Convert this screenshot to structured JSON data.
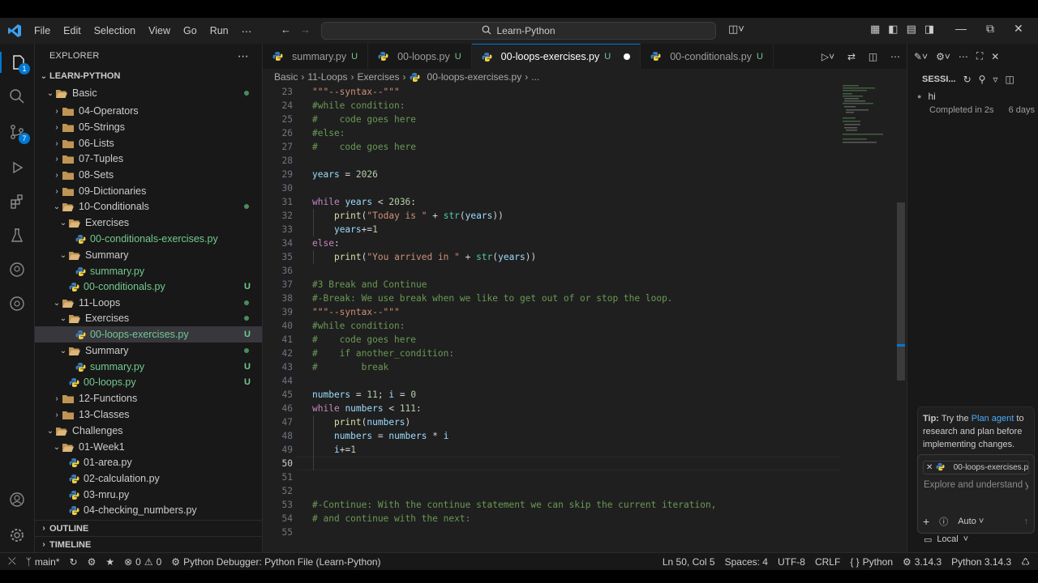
{
  "menu": [
    "File",
    "Edit",
    "Selection",
    "View",
    "Go",
    "Run",
    "⋯"
  ],
  "search": {
    "label": "Learn-Python"
  },
  "activity": {
    "explorer_badge": "1",
    "scm_badge": "7"
  },
  "explorer": {
    "title": "EXPLORER",
    "root": "LEARN-PYTHON",
    "items": [
      {
        "label": "Basic",
        "kind": "folder-open",
        "depth": 1
      },
      {
        "label": "04-Operators",
        "kind": "folder",
        "depth": 2
      },
      {
        "label": "05-Strings",
        "kind": "folder",
        "depth": 2
      },
      {
        "label": "06-Lists",
        "kind": "folder",
        "depth": 2
      },
      {
        "label": "07-Tuples",
        "kind": "folder",
        "depth": 2
      },
      {
        "label": "08-Sets",
        "kind": "folder",
        "depth": 2
      },
      {
        "label": "09-Dictionaries",
        "kind": "folder",
        "depth": 2
      },
      {
        "label": "10-Conditionals",
        "kind": "folder-open",
        "depth": 2
      },
      {
        "label": "Exercises",
        "kind": "folder-open",
        "depth": 3
      },
      {
        "label": "00-conditionals-exercises.py",
        "kind": "py",
        "depth": 4
      },
      {
        "label": "Summary",
        "kind": "folder-open",
        "depth": 3
      },
      {
        "label": "summary.py",
        "kind": "py",
        "depth": 4
      },
      {
        "label": "00-conditionals.py",
        "kind": "py",
        "depth": 3
      },
      {
        "label": "11-Loops",
        "kind": "folder-open",
        "depth": 2
      },
      {
        "label": "Exercises",
        "kind": "folder-open",
        "depth": 3
      },
      {
        "label": "00-loops-exercises.py",
        "kind": "py",
        "depth": 4
      },
      {
        "label": "Summary",
        "kind": "folder-open",
        "depth": 3
      },
      {
        "label": "summary.py",
        "kind": "py",
        "depth": 4
      },
      {
        "label": "00-loops.py",
        "kind": "py",
        "depth": 3
      },
      {
        "label": "12-Functions",
        "kind": "folder",
        "depth": 2
      },
      {
        "label": "13-Classes",
        "kind": "folder",
        "depth": 2
      },
      {
        "label": "Challenges",
        "kind": "folder-open",
        "depth": 1
      },
      {
        "label": "01-Week1",
        "kind": "folder-open",
        "depth": 2
      },
      {
        "label": "01-area.py",
        "kind": "py",
        "depth": 3
      },
      {
        "label": "02-calculation.py",
        "kind": "py",
        "depth": 3
      },
      {
        "label": "03-mru.py",
        "kind": "py",
        "depth": 3
      },
      {
        "label": "04-checking_numbers.py",
        "kind": "py",
        "depth": 3
      }
    ],
    "git_marker": "U",
    "outline": "OUTLINE",
    "timeline": "TIMELINE"
  },
  "tabs": [
    {
      "label": "summary.py",
      "status": "U"
    },
    {
      "label": "00-loops.py",
      "status": "U"
    },
    {
      "label": "00-loops-exercises.py",
      "status": "U"
    },
    {
      "label": "00-conditionals.py",
      "status": "U"
    }
  ],
  "breadcrumb": [
    "Basic",
    "11-Loops",
    "Exercises",
    "00-loops-exercises.py",
    "..."
  ],
  "code": {
    "line_numbers": [
      "23",
      "24",
      "25",
      "26",
      "27",
      "28",
      "29",
      "30",
      "31",
      "32",
      "33",
      "34",
      "35",
      "36",
      "37",
      "38",
      "39",
      "40",
      "41",
      "42",
      "43",
      "44",
      "45",
      "46",
      "47",
      "48",
      "49",
      "50",
      "51",
      "52",
      "53",
      "54",
      "55"
    ],
    "current_line": "50"
  },
  "chat": {
    "title": "SESSI...",
    "session_title": "hi",
    "session_status": "Completed in 2s",
    "session_age": "6 days",
    "tip_bold": "Tip:",
    "tip_text1": " Try the ",
    "tip_link": "Plan agent",
    "tip_text2": " to research and plan before implementing changes.",
    "attachment": "00-loops-exercises.p",
    "placeholder": "Explore and understand y",
    "mode": "Auto",
    "location": "Local"
  },
  "status": {
    "branch": "main*",
    "errors": "0",
    "warnings": "0",
    "debugger": "Python Debugger: Python File (Learn-Python)",
    "position": "Ln 50, Col 5",
    "spaces": "Spaces: 4",
    "encoding": "UTF-8",
    "eol": "CRLF",
    "language": "Python",
    "py_version": "3.14.3",
    "interpreter": "Python 3.14.3"
  }
}
